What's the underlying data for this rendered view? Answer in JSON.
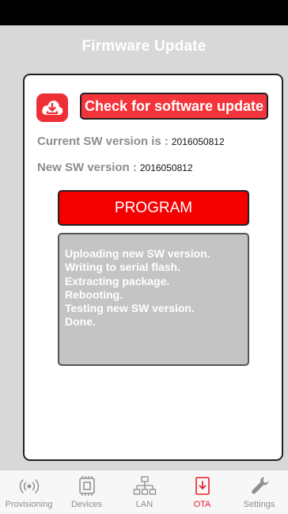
{
  "header": {
    "title": "Firmware Update"
  },
  "actions": {
    "check_update_label": "Check for software update"
  },
  "versions": {
    "current_label": "Current SW version is :",
    "current_value": "2016050812",
    "new_label": "New SW version :",
    "new_value": "2016050812"
  },
  "program": {
    "label": "PROGRAM"
  },
  "log": {
    "lines": [
      "Uploading new SW version.",
      "Writing to serial flash.",
      "Extracting package.",
      "Rebooting.",
      "Testing new SW version.",
      "Done."
    ]
  },
  "tabs": [
    {
      "label": "Provisioning",
      "icon": "wireless-signal-icon"
    },
    {
      "label": "Devices",
      "icon": "chip-icon"
    },
    {
      "label": "LAN",
      "icon": "network-icon"
    },
    {
      "label": "OTA",
      "icon": "download-box-icon",
      "active": true
    },
    {
      "label": "Settings",
      "icon": "wrench-icon"
    }
  ],
  "colors": {
    "accent": "#f40000",
    "button_red": "#f4333a",
    "log_bg": "#c4c4c4",
    "page_bg": "#d8d8d8"
  }
}
